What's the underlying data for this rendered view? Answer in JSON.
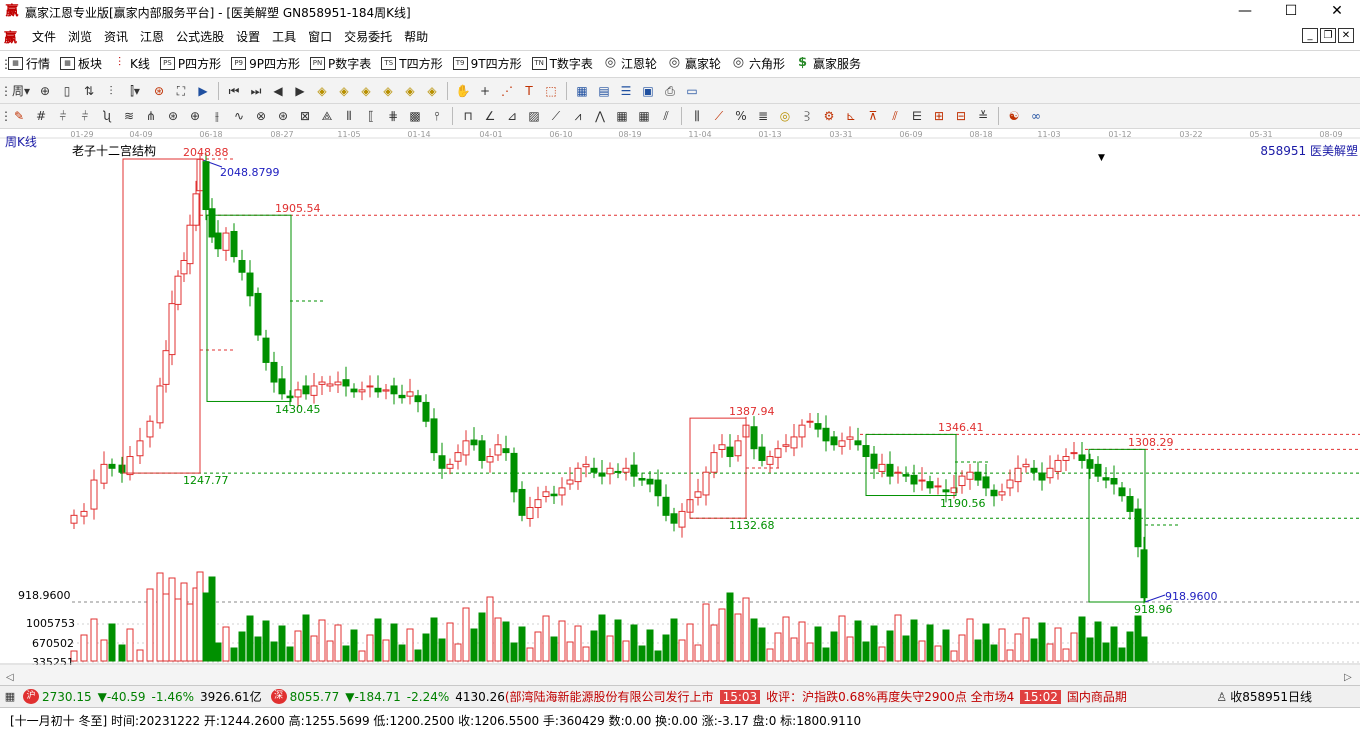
{
  "window": {
    "app_logo": "赢",
    "title": "赢家江恩专业版[赢家内部服务平台] - [医美解塑  GN858951-184周K线]",
    "minimize": "—",
    "maximize": "☐",
    "close": "✕"
  },
  "menu": {
    "logo": "赢",
    "items": [
      "文件",
      "浏览",
      "资讯",
      "江恩",
      "公式选股",
      "设置",
      "工具",
      "窗口",
      "交易委托",
      "帮助"
    ],
    "mdi_min": "_",
    "mdi_restore": "❐",
    "mdi_close": "✕"
  },
  "toolbar1": {
    "items": [
      {
        "icon": "grid-icon",
        "glyph": "▦",
        "label": "行情"
      },
      {
        "icon": "sector-icon",
        "glyph": "▦",
        "label": "板块"
      },
      {
        "icon": "kline-icon",
        "glyph": "⫶",
        "label": "K线"
      },
      {
        "icon": "ps-icon",
        "glyph": "PS",
        "label": "P四方形"
      },
      {
        "icon": "p9-icon",
        "glyph": "P9",
        "label": "9P四方形"
      },
      {
        "icon": "pn-icon",
        "glyph": "PN",
        "label": "P数字表"
      },
      {
        "icon": "ts-icon",
        "glyph": "TS",
        "label": "T四方形"
      },
      {
        "icon": "t9-icon",
        "glyph": "T9",
        "label": "9T四方形"
      },
      {
        "icon": "tn-icon",
        "glyph": "TN",
        "label": "T数字表"
      },
      {
        "icon": "gann-wheel-icon",
        "glyph": "◎",
        "label": "江恩轮"
      },
      {
        "icon": "winner-wheel-icon",
        "glyph": "◎",
        "label": "赢家轮"
      },
      {
        "icon": "hexagon-icon",
        "glyph": "◎",
        "label": "六角形"
      },
      {
        "icon": "dollar-icon",
        "glyph": "$",
        "label": "赢家服务"
      }
    ]
  },
  "chart": {
    "period_label": "周K线",
    "indicator_label": "老子十二宫结构",
    "right_code": "858951  医美解塑",
    "volume_axis": [
      "1005753",
      "670502",
      "335251"
    ],
    "low_axis_label": "918.9600",
    "dropdown_marker": "▼",
    "x_ticks": [
      "01-29",
      "04-09",
      "06-18",
      "08-27",
      "11-05",
      "01-14",
      "04-01",
      "06-10",
      "08-19",
      "11-04",
      "01-13",
      "03-31",
      "06-09",
      "08-18",
      "11-03",
      "01-12",
      "03-22",
      "05-31",
      "08-09"
    ],
    "annotations": {
      "high1": "2048.88",
      "high1_blue": "2048.8799",
      "level_1905": "1905.54",
      "low_1430": "1430.45",
      "low_1247": "1247.77",
      "high_1387": "1387.94",
      "low_1132": "1132.68",
      "high_1346": "1346.41",
      "low_1190": "1190.56",
      "high_1308": "1308.29",
      "low_918_blue": "918.9600",
      "low_918": "918.96"
    }
  },
  "status": {
    "sh_index": "2730.15",
    "sh_change": "▼-40.59",
    "sh_pct": "-1.46%",
    "sh_amount": "3926.61亿",
    "sz_index": "8055.77",
    "sz_change": "▼-184.71",
    "sz_pct": "-2.24%",
    "sz_amount": "4130.26",
    "news1": "(部湾陆海新能源股份有限公司发行上市",
    "time1": "15:03",
    "news2": "收评：沪指跌0.68%再度失守2900点 全市场4",
    "time2": "15:02",
    "news3": "国内商品期",
    "right_text": "收858951日线"
  },
  "info": {
    "text": "[十一月初十 冬至] 时间:20231222 开:1244.2600 高:1255.5699 低:1200.2500 收:1206.5500 手:360429 数:0.00 换:0.00 涨:-3.17 盘:0 标:1800.9110"
  }
}
